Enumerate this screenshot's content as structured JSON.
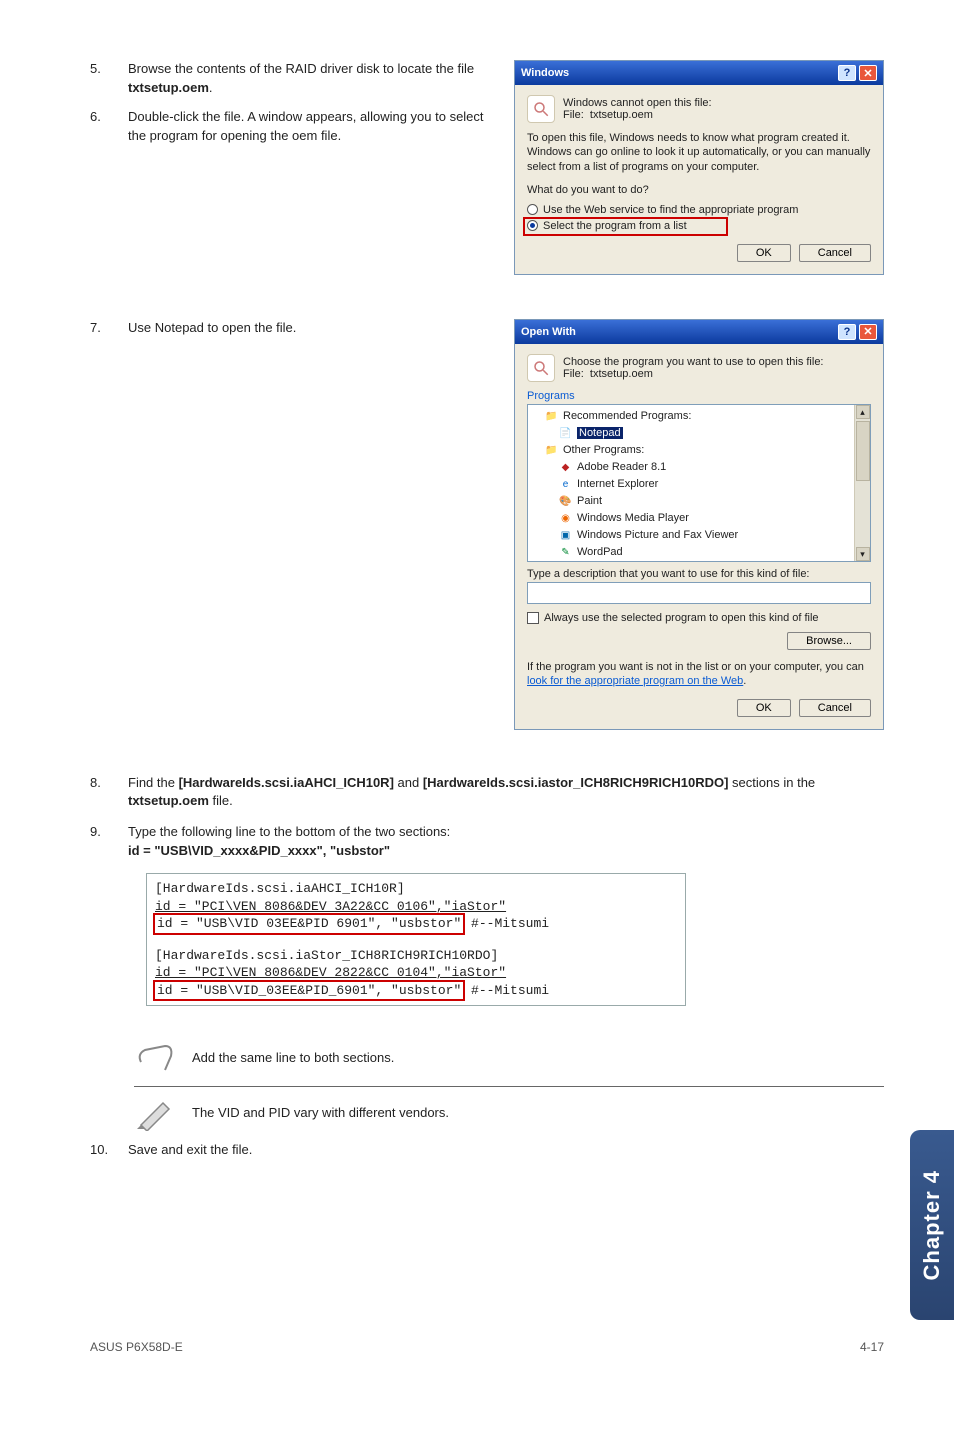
{
  "steps": {
    "s5": {
      "num": "5.",
      "text_a": "Browse the contents of the RAID driver disk to locate the file ",
      "b1": "txtsetup.oem",
      "text_b": "."
    },
    "s6": {
      "num": "6.",
      "text": "Double-click the file. A window appears, allowing you to select the program for opening the oem file."
    },
    "s7": {
      "num": "7.",
      "text": "Use Notepad to open the file."
    },
    "s8": {
      "num": "8.",
      "text_a": "Find the ",
      "b1": "[HardwareIds.scsi.iaAHCI_ICH10R]",
      "text_b": " and ",
      "b2": "[HardwareIds.scsi.iastor_ICH8RICH9RICH10RDO]",
      "text_c": " sections in the ",
      "b3": "txtsetup.oem",
      "text_d": " file."
    },
    "s9": {
      "num": "9.",
      "text": "Type the following line to the bottom of the two sections:",
      "bold": "id = \"USB\\VID_xxxx&PID_xxxx\", \"usbstor\""
    },
    "s10": {
      "num": "10.",
      "text": "Save and exit the file."
    }
  },
  "dlg1": {
    "title": "Windows",
    "cant_open": "Windows cannot open this file:",
    "file_lbl": "File:",
    "file_name": "txtsetup.oem",
    "help": "To open this file, Windows needs to know what program created it.  Windows can go online to look it up automatically, or you can manually select from a list of programs on your computer.",
    "what": "What do you want to do?",
    "r1": "Use the Web service to find the appropriate program",
    "r2": "Select the program from a list",
    "ok": "OK",
    "cancel": "Cancel"
  },
  "dlg2": {
    "title": "Open With",
    "choose": "Choose the program you want to use to open this file:",
    "file_lbl": "File:",
    "file_name": "txtsetup.oem",
    "programs": "Programs",
    "rec": "Recommended Programs:",
    "notepad": "Notepad",
    "other": "Other Programs:",
    "items": [
      "Adobe Reader 8.1",
      "Internet Explorer",
      "Paint",
      "Windows Media Player",
      "Windows Picture and Fax Viewer",
      "WordPad"
    ],
    "desc": "Type a description that you want to use for this kind of file:",
    "always": "Always use the selected program to open this kind of file",
    "browse": "Browse...",
    "bottom": "If the program you want is not in the list or on your computer, you can ",
    "look": "look for the appropriate program on the Web",
    "dot": ".",
    "ok": "OK",
    "cancel": "Cancel"
  },
  "code": {
    "l1": "[HardwareIds.scsi.iaAHCI_ICH10R]",
    "l2": "id = \"PCI\\VEN_8086&DEV_3A22&CC_0106\",\"iaStor\"",
    "l3": "id = \"USB\\VID 03EE&PID 6901\", \"usbstor\"",
    "l3_tail": " #--Mitsumi",
    "l4": "[HardwareIds.scsi.iaStor_ICH8RICH9RICH10RDO]",
    "l5": "id = \"PCI\\VEN_8086&DEV_2822&CC_0104\",\"iaStor\"",
    "l6": "id = \"USB\\VID_03EE&PID_6901\", \"usbstor\"",
    "l6_tail": " #--Mitsumi"
  },
  "notes": {
    "n1": "Add the same line to both sections.",
    "n2": "The VID and PID vary with different vendors."
  },
  "side_tab": "Chapter 4",
  "footer_left": "ASUS P6X58D-E",
  "footer_right": "4-17"
}
